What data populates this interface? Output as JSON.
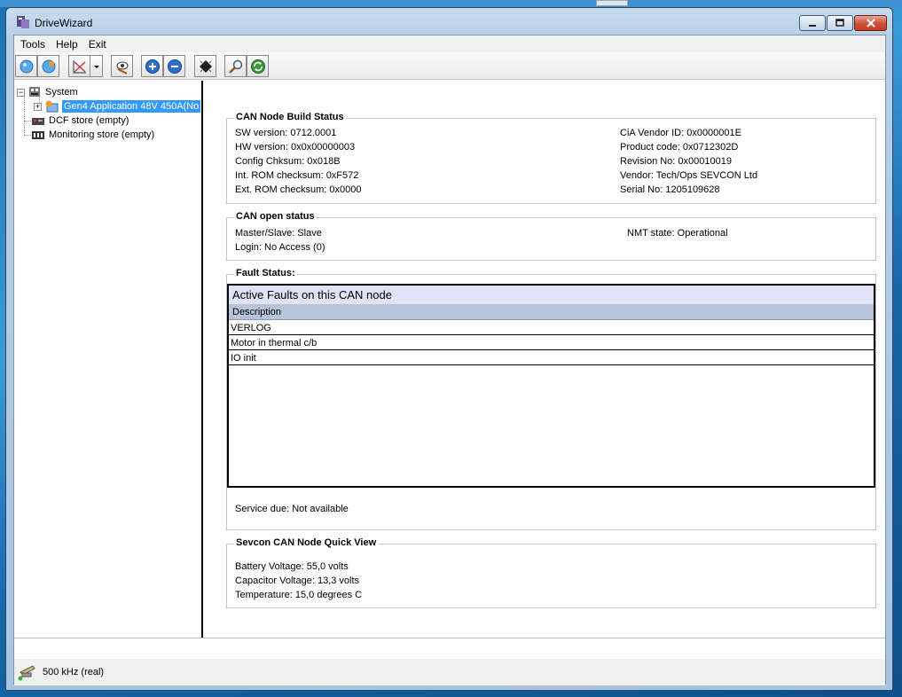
{
  "window": {
    "title": "DriveWizard"
  },
  "menu": [
    "Tools",
    "Help",
    "Exit"
  ],
  "toolbar": {
    "buttons": [
      "connect-icon",
      "disconnect-icon",
      "graph-icon",
      "dropdown-arrow-icon",
      "eye-icon",
      "zoom-in-icon",
      "zoom-out-icon",
      "chip-icon",
      "search-icon",
      "refresh-icon"
    ]
  },
  "tree": {
    "system": "System",
    "node": "Gen4 Application 48V 450A(No",
    "dcf": "DCF store (empty)",
    "monitoring": "Monitoring store (empty)"
  },
  "build_status": {
    "title": "CAN Node Build Status",
    "left": [
      "SW version: 0712.0001",
      "HW version: 0x0x00000003",
      "Config Chksum: 0x018B",
      "Int. ROM checksum: 0xF572",
      "Ext. ROM checksum: 0x0000"
    ],
    "right": [
      "CiA Vendor ID: 0x0000001E",
      "Product code: 0x0712302D",
      "Revision No: 0x00010019",
      "Vendor: Tech/Ops SEVCON Ltd",
      "Serial No: 1205109628"
    ]
  },
  "canopen": {
    "title": "CAN open status",
    "master_slave": "Master/Slave: Slave",
    "login": "Login: No Access (0)",
    "nmt": "NMT state: Operational"
  },
  "fault": {
    "title": "Fault Status:",
    "panel_title": "Active Faults on this CAN node",
    "column": "Description",
    "rows": [
      "VERLOG",
      "Motor in thermal c/b",
      "IO init"
    ],
    "service": "Service due: Not available"
  },
  "quickview": {
    "title": "Sevcon CAN Node Quick View",
    "battery": "Battery Voltage: 55,0 volts",
    "capacitor": "Capacitor Voltage: 13,3 volts",
    "temperature": "Temperature: 15,0 degrees C"
  },
  "status": {
    "text": "500 kHz (real)"
  },
  "colors": {
    "selection": "#3399ff",
    "fault_header": "#dfe3f5",
    "fault_column": "#b8c3da"
  }
}
